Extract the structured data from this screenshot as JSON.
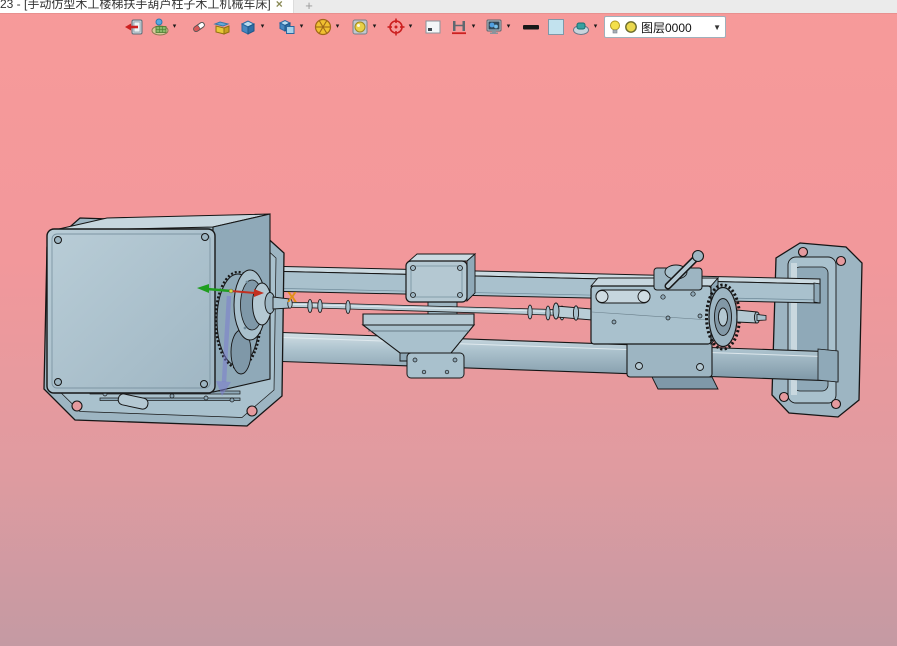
{
  "window": {
    "tab_title": "23 - [手动仿型木工楼梯扶手葫芦柱子木工机械车床]",
    "tab_close_glyph": "×",
    "new_tab_glyph": "+"
  },
  "toolbar": {
    "items": [
      {
        "name": "exit",
        "dropdown": false
      },
      {
        "name": "material",
        "dropdown": true
      },
      {
        "name": "eraser",
        "dropdown": false
      },
      {
        "name": "isometric-box",
        "dropdown": false
      },
      {
        "name": "view-cube",
        "dropdown": true
      },
      {
        "name": "display-style",
        "dropdown": true
      },
      {
        "name": "view-wheel",
        "dropdown": true
      },
      {
        "name": "render-mode",
        "dropdown": true
      },
      {
        "name": "origin-target",
        "dropdown": true
      },
      {
        "name": "frame-corner",
        "dropdown": false
      },
      {
        "name": "section",
        "dropdown": true
      },
      {
        "name": "system-monitor",
        "dropdown": true
      },
      {
        "name": "line-width",
        "dropdown": false
      },
      {
        "name": "color-swatch",
        "dropdown": false
      },
      {
        "name": "pick-hand",
        "dropdown": true
      }
    ],
    "layer_combo": {
      "bulb_icon": "light-bulb",
      "color_icon": "layer-color-circle",
      "label": "图层0000",
      "dropdown_glyph": "▼"
    }
  },
  "icons": {
    "dropdown_arrow": "▾"
  },
  "viewport": {
    "axis_label": "X"
  },
  "colors": {
    "background_top": "#f79a9a",
    "background_bottom": "#c49aa3",
    "model_face": "#a9c1cd",
    "model_face_light": "#c6d6de",
    "model_face_dark": "#8fa9b8",
    "outline": "#161616",
    "bolt_hole": "#e59a9e",
    "axis_x_label": "#e09018",
    "axis_green": "#1f9e1f",
    "axis_red": "#c23020",
    "axis_blue": "#7b7bd0",
    "tab_bar_bg": "#ebebeb",
    "active_tab_bg": "#ffffff"
  }
}
